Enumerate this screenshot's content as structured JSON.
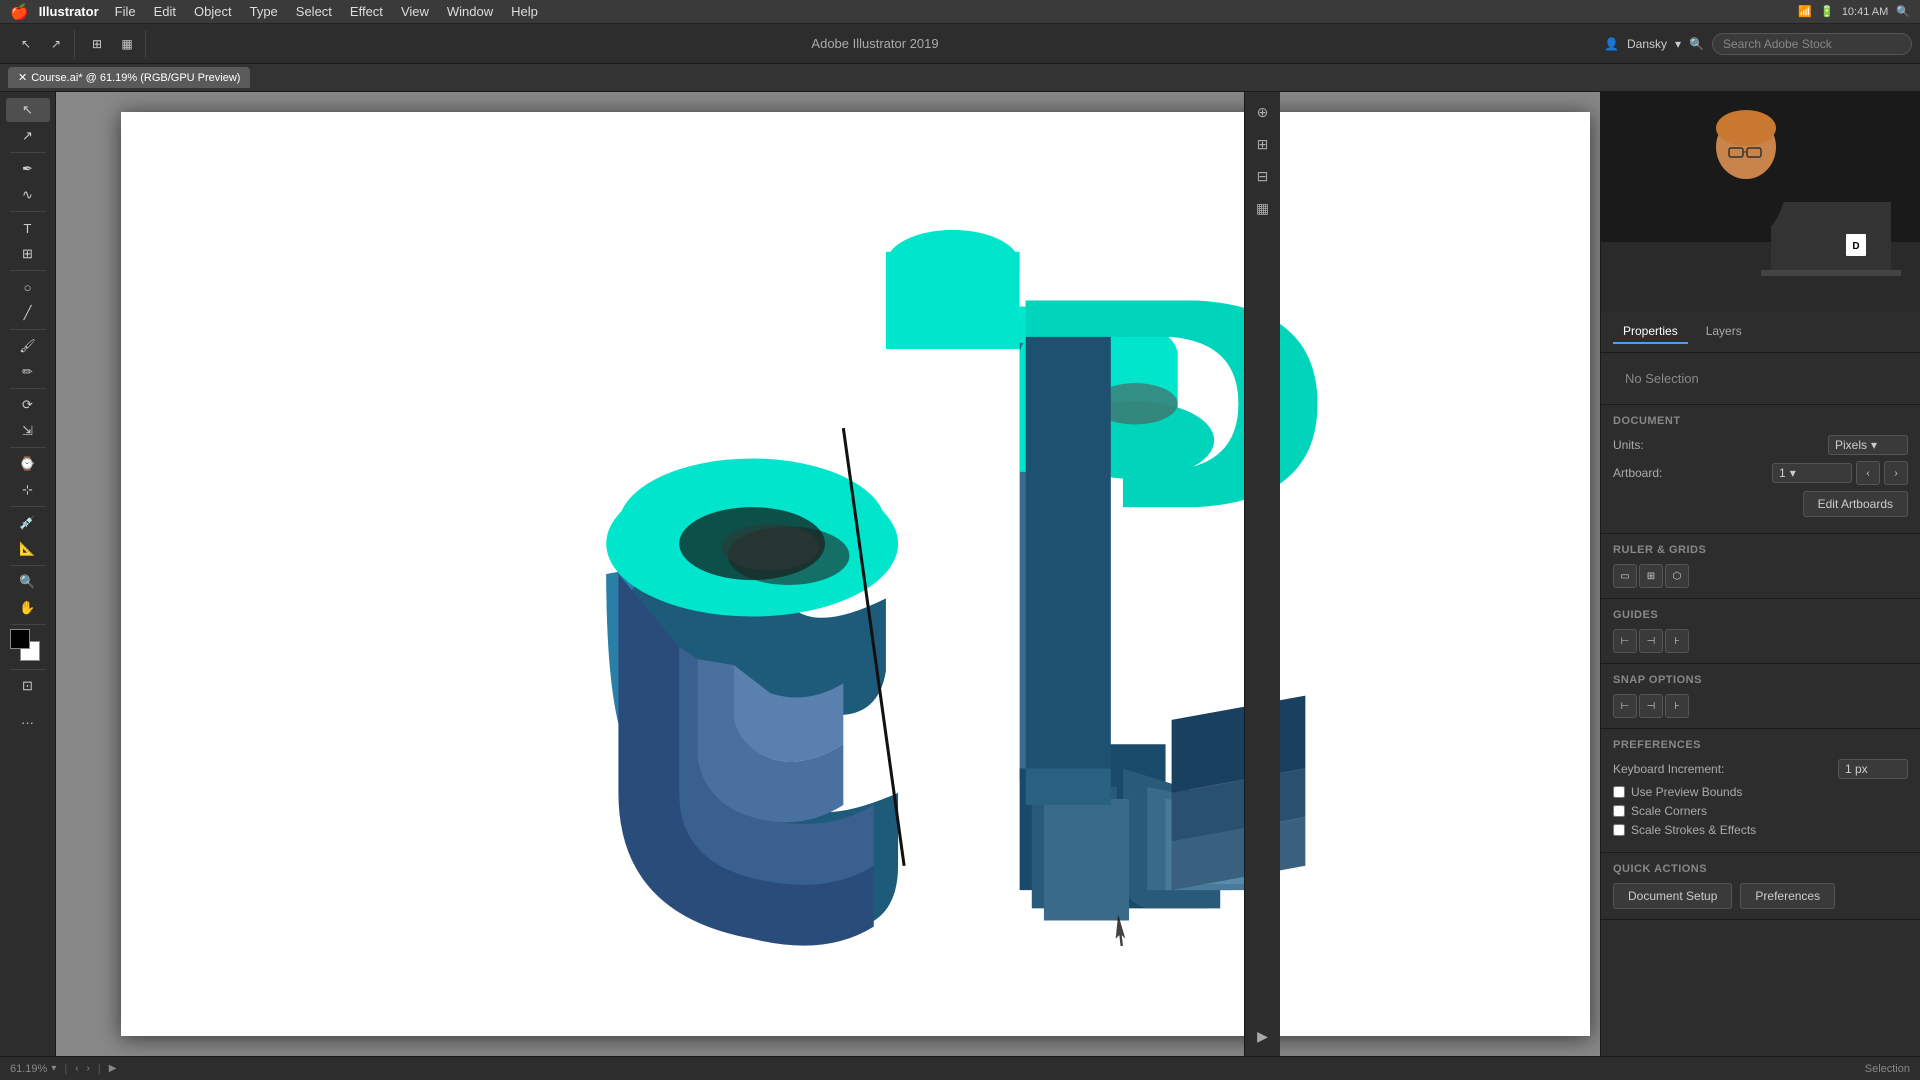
{
  "menuBar": {
    "apple": "🍎",
    "appName": "Illustrator",
    "items": [
      "File",
      "Edit",
      "Object",
      "Type",
      "Select",
      "Effect",
      "View",
      "Window",
      "Help"
    ],
    "rightIcons": [
      "⊞",
      "⊟",
      "⊠",
      "⊡",
      "WiFi",
      "■",
      "▲",
      "Q"
    ]
  },
  "toolbar": {
    "title": "Adobe Illustrator 2019",
    "searchPlaceholder": "Search Adobe Stock",
    "userLabel": "Dansky"
  },
  "tabBar": {
    "tabs": [
      {
        "label": "Course.ai* @ 61.19% (RGB/GPU Preview)",
        "active": true
      }
    ]
  },
  "statusBar": {
    "zoom": "61.19%",
    "mode": "Selection"
  },
  "properties": {
    "panelTabs": [
      "Properties",
      "Layers"
    ],
    "activePanelTab": "Properties",
    "noSelection": "No Selection",
    "documentSection": "Document",
    "unitsLabel": "Units:",
    "unitsValue": "Pixels",
    "artboardLabel": "Artboard:",
    "artboardValue": "1",
    "editArtboardsBtn": "Edit Artboards",
    "rulerGridsLabel": "Ruler & Grids",
    "guidesLabel": "Guides",
    "snapOptionsLabel": "Snap Options",
    "preferencesSection": "Preferences",
    "keyboardIncrementLabel": "Keyboard Increment:",
    "keyboardIncrementValue": "1 px",
    "usePreviewBounds": "Use Preview Bounds",
    "scaleCorners": "Scale Corners",
    "scaleStrokesEffects": "Scale Strokes & Effects",
    "quickActionsSection": "Quick Actions",
    "documentSetupBtn": "Document Setup",
    "preferencesBtn": "Preferences"
  },
  "tools": {
    "items": [
      "↖",
      "↗",
      "✏",
      "⊕",
      "T",
      "⊞",
      "○",
      "✂",
      "◈",
      "↔",
      "⟳",
      "◻",
      "☁",
      "⌛",
      "✎",
      "🔍",
      "✋",
      "⊡"
    ]
  }
}
